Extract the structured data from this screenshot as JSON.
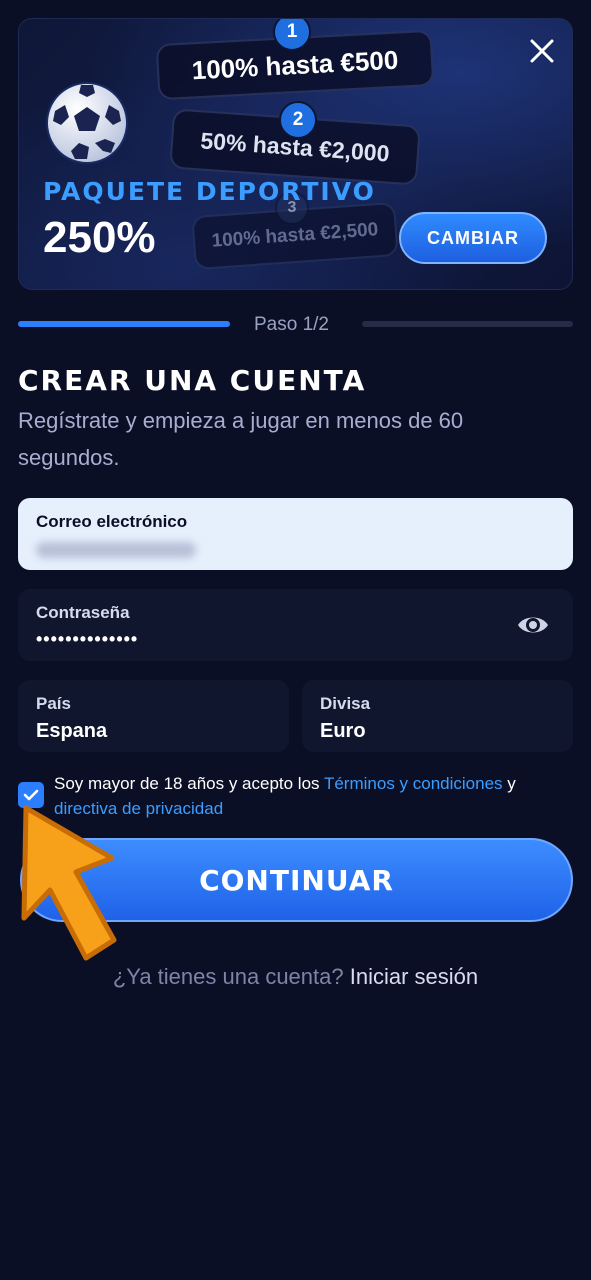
{
  "promo": {
    "tiers": [
      {
        "step": "1",
        "text": "100% hasta €500"
      },
      {
        "step": "2",
        "text": "50% hasta €2,000"
      },
      {
        "step": "3",
        "text": "100% hasta €2,500"
      }
    ],
    "package_label": "PAQUETE DEPORTIVO",
    "package_percent": "250%",
    "change_label": "CAMBIAR"
  },
  "progress": {
    "label": "Paso 1/2",
    "current_step": 1,
    "total_steps": 2
  },
  "form": {
    "title": "CREAR UNA CUENTA",
    "subtitle": "Regístrate y empieza a jugar en menos de 60 segundos.",
    "email": {
      "label": "Correo electrónico"
    },
    "password": {
      "label": "Contraseña",
      "value": "••••••••••••••"
    },
    "country": {
      "label": "País",
      "value": "Espana"
    },
    "currency": {
      "label": "Divisa",
      "value": "Euro"
    },
    "terms": {
      "checked": true,
      "prefix": "Soy mayor de 18 años y acepto los ",
      "terms_link": "Términos y condiciones",
      "connector": " y ",
      "privacy_link": "directiva de privacidad"
    },
    "continue_label": "CONTINUAR"
  },
  "login": {
    "question": "¿Ya tienes una cuenta?",
    "link": "Iniciar sesión"
  },
  "colors": {
    "background": "#0b0f26",
    "accent": "#2b7fff",
    "pointer": "#f7a11a"
  },
  "icons": [
    "close-icon",
    "soccer-ball-icon",
    "eye-icon",
    "check-icon",
    "pointer-arrow-icon"
  ]
}
